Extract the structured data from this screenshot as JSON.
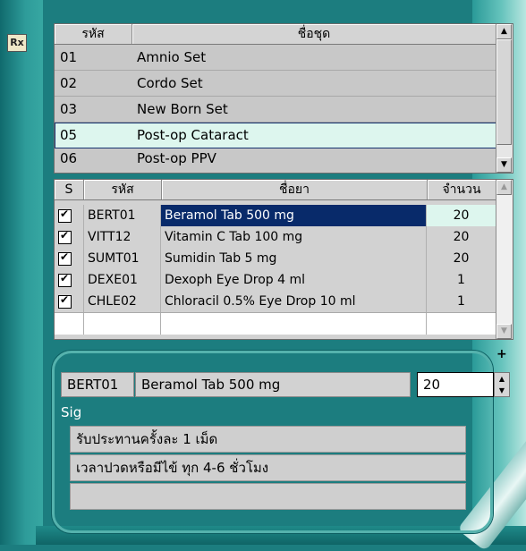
{
  "sets": {
    "headers": {
      "code": "รหัส",
      "name": "ชื่อชุด"
    },
    "rows": [
      {
        "code": "01",
        "name": "Amnio Set"
      },
      {
        "code": "02",
        "name": "Cordo Set"
      },
      {
        "code": "03",
        "name": "New Born Set"
      },
      {
        "code": "05",
        "name": "Post-op Cataract"
      },
      {
        "code": "06",
        "name": "Post-op PPV"
      }
    ],
    "selected_index": 3
  },
  "drugs": {
    "headers": {
      "s": "S",
      "code": "รหัส",
      "name": "ชื่อยา",
      "qty": "จำนวน"
    },
    "rows": [
      {
        "checked": true,
        "code": "BERT01",
        "name": "Beramol Tab 500 mg",
        "qty": "20"
      },
      {
        "checked": true,
        "code": "VITT12",
        "name": "Vitamin C Tab 100 mg",
        "qty": "20"
      },
      {
        "checked": true,
        "code": "SUMT01",
        "name": "Sumidin Tab 5 mg",
        "qty": "20"
      },
      {
        "checked": true,
        "code": "DEXE01",
        "name": "Dexoph Eye Drop 4 ml",
        "qty": "1"
      },
      {
        "checked": true,
        "code": "CHLE02",
        "name": "Chloracil 0.5% Eye Drop 10 ml",
        "qty": "1"
      }
    ],
    "selected_index": 0
  },
  "detail": {
    "code": "BERT01",
    "name": "Beramol Tab 500 mg",
    "qty": "20",
    "sig_label": "Sig",
    "sig_lines": [
      "รับประทานครั้งละ 1 เม็ด",
      "เวลาปวดหรือมีไข้ ทุก 4-6 ชั่วโมง",
      ""
    ],
    "add_label": "+"
  },
  "icons": {
    "rx": "Rx"
  },
  "colors": {
    "background": "#1c7d7f",
    "selected_row": "#ddf6ee",
    "highlight": "#082a6a"
  }
}
